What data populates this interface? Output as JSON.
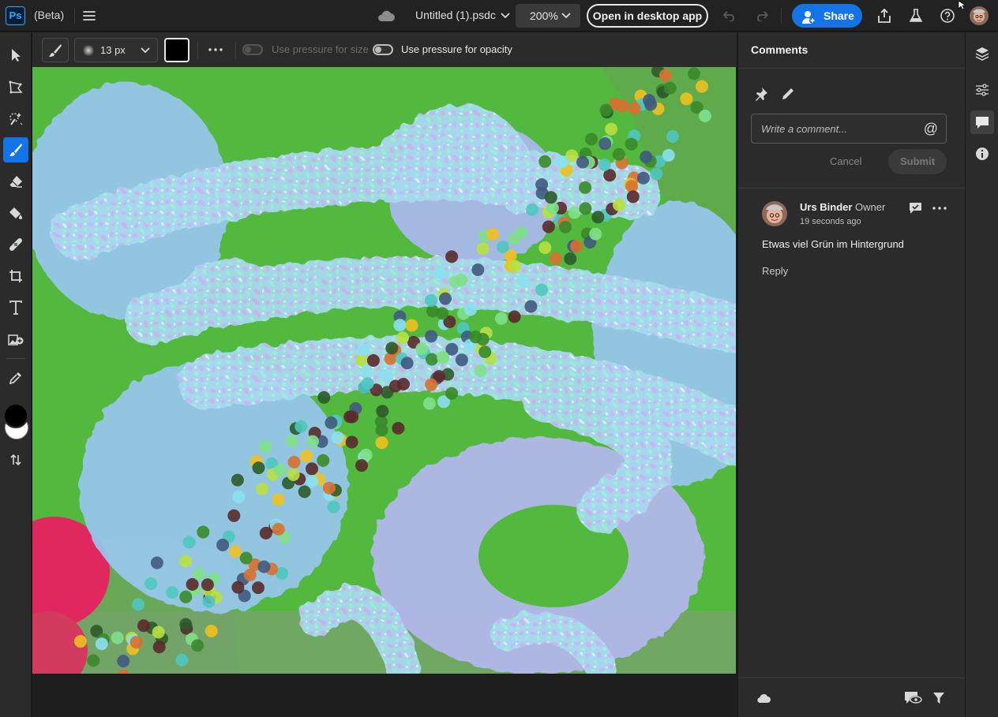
{
  "app": {
    "logo_text": "Ps",
    "beta_label": "(Beta)",
    "file_name": "Untitled (1).psdc",
    "zoom_level": "200%",
    "open_desktop_label": "Open in desktop app",
    "share_label": "Share"
  },
  "options_bar": {
    "brush_size": "13 px",
    "pressure_size_label": "Use pressure for size",
    "pressure_opacity_label": "Use pressure for opacity",
    "pressure_size_on": false,
    "pressure_opacity_on": false,
    "color_swatch": "#000000"
  },
  "tools": [
    {
      "name": "move-tool-icon"
    },
    {
      "name": "lasso-tool-icon"
    },
    {
      "name": "quick-select-tool-icon"
    },
    {
      "name": "brush-tool-icon",
      "active": true
    },
    {
      "name": "eraser-tool-icon"
    },
    {
      "name": "paint-bucket-tool-icon"
    },
    {
      "name": "healing-tool-icon"
    },
    {
      "name": "crop-tool-icon"
    },
    {
      "name": "type-tool-icon"
    },
    {
      "name": "add-image-tool-icon"
    },
    {
      "name": "eyedropper-tool-icon"
    }
  ],
  "colors": {
    "foreground": "#000000",
    "background": "#ffffff",
    "accent": "#1473e6",
    "canvas_green": "#58b842"
  },
  "comments": {
    "title": "Comments",
    "input_placeholder": "Write a comment...",
    "at_symbol": "@",
    "cancel_label": "Cancel",
    "submit_label": "Submit",
    "items": [
      {
        "author": "Urs Binder",
        "role": "Owner",
        "time": "19 seconds ago",
        "text": "Etwas viel Grün im Hintergrund",
        "reply_label": "Reply"
      }
    ]
  }
}
